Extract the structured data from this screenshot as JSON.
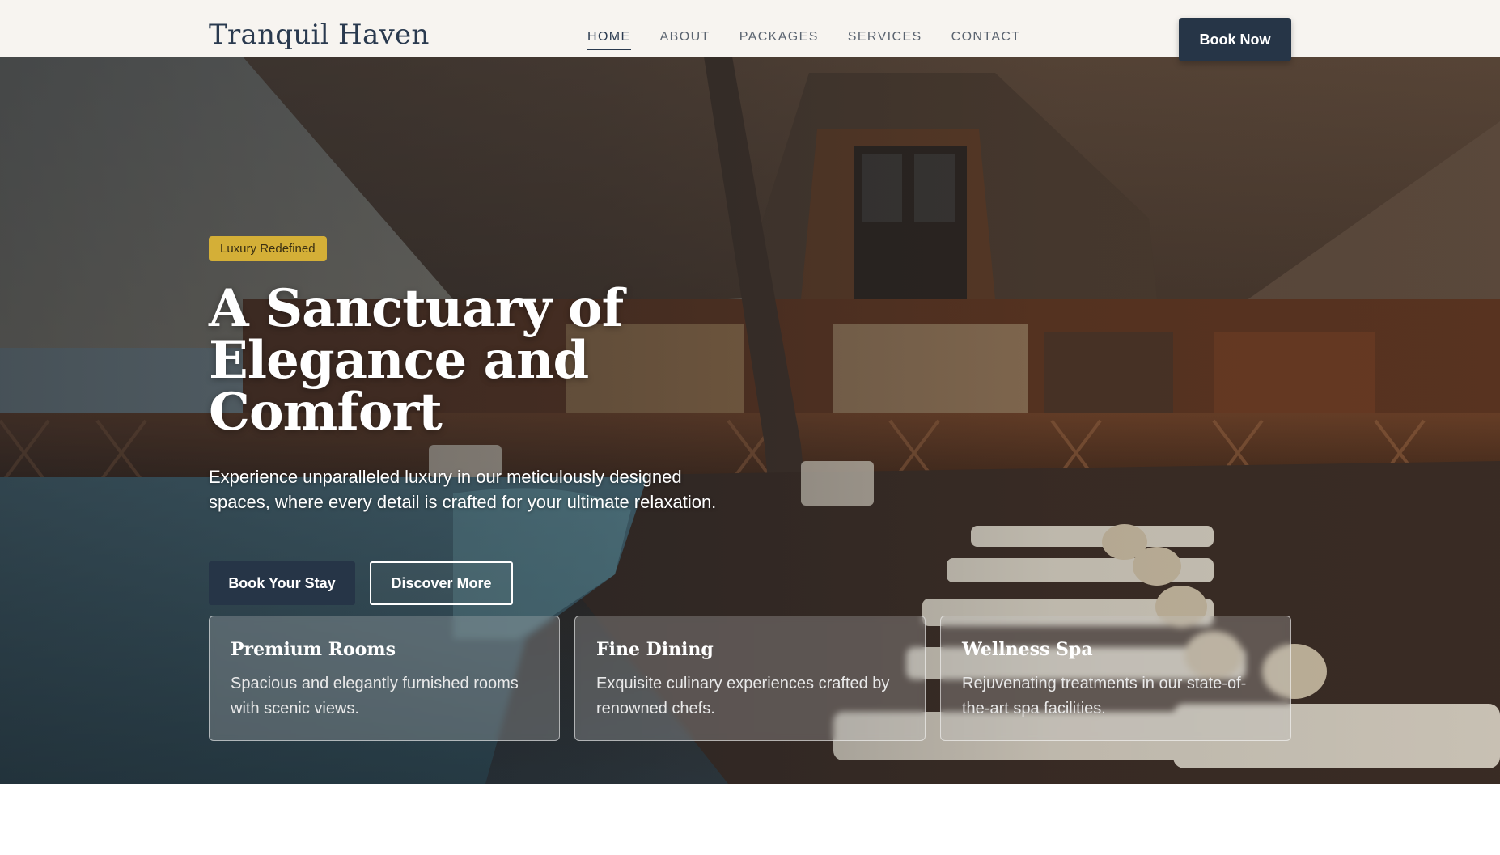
{
  "header": {
    "logo": "Tranquil Haven",
    "nav": [
      "HOME",
      "ABOUT",
      "PACKAGES",
      "SERVICES",
      "CONTACT"
    ],
    "active_nav": "HOME",
    "book_button": "Book Now"
  },
  "hero": {
    "badge": "Luxury Redefined",
    "title": "A Sanctuary of Elegance and Comfort",
    "subtitle": "Experience unparalleled luxury in our meticulously designed spaces, where every detail is crafted for your ultimate relaxation.",
    "primary_button": "Book Your Stay",
    "secondary_button": "Discover More"
  },
  "features": [
    {
      "title": "Premium Rooms",
      "text": "Spacious and elegantly furnished rooms with scenic views."
    },
    {
      "title": "Fine Dining",
      "text": "Exquisite culinary experiences crafted by renowned chefs."
    },
    {
      "title": "Wellness Spa",
      "text": "Rejuvenating treatments in our state-of-the-art spa facilities."
    }
  ],
  "colors": {
    "brand": "#263547",
    "badge": "#d4af37",
    "header_bg": "#f7f4f0"
  }
}
